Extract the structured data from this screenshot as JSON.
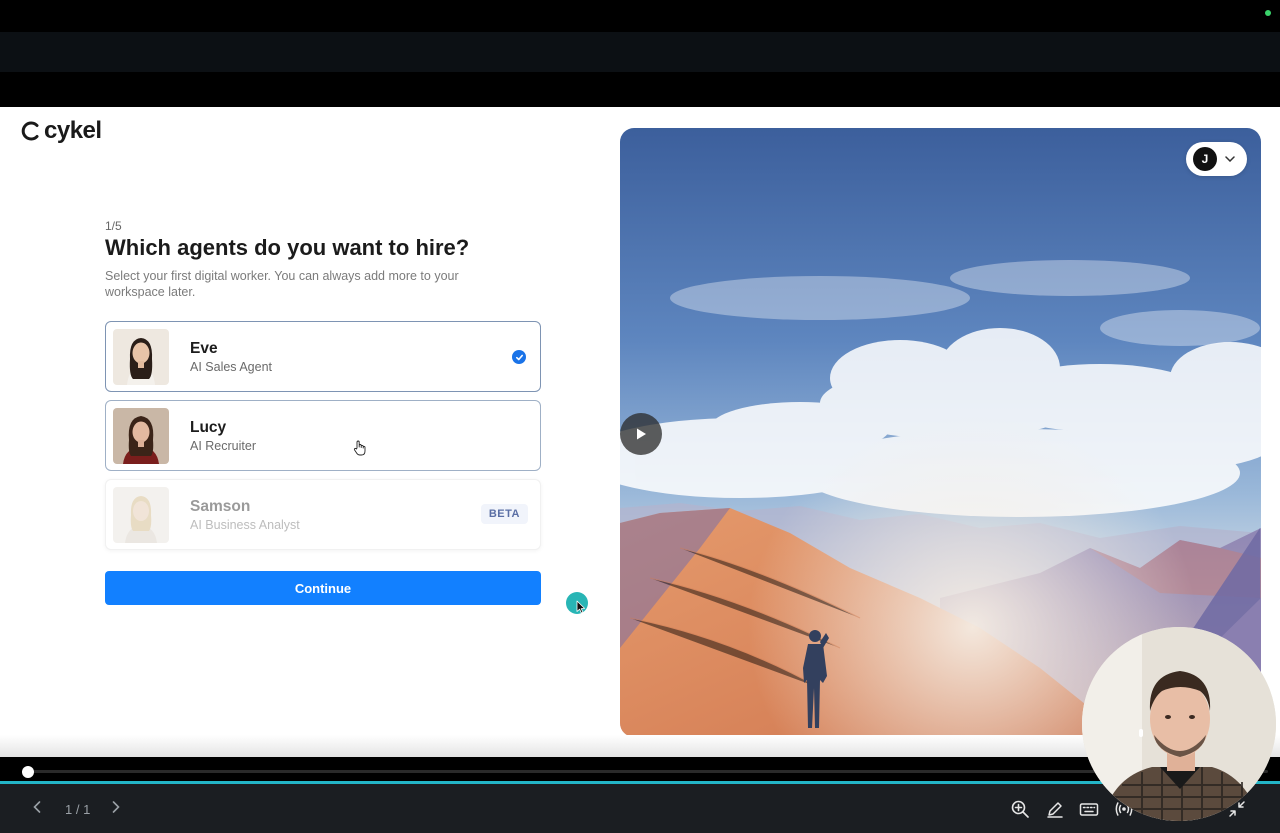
{
  "brand": {
    "name": "cykel"
  },
  "onboarding": {
    "step": "1/5",
    "title": "Which agents do you want to hire?",
    "subtitle": "Select your first digital worker. You can always add more to your workspace later.",
    "continue_label": "Continue"
  },
  "agents": [
    {
      "name": "Eve",
      "role": "AI Sales Agent",
      "selected": true
    },
    {
      "name": "Lucy",
      "role": "AI Recruiter",
      "selected": false
    },
    {
      "name": "Samson",
      "role": "AI Business Analyst",
      "badge": "BETA",
      "disabled": true
    }
  ],
  "user": {
    "initial": "J"
  },
  "player": {
    "page": "1 / 1",
    "progress": 0.005
  },
  "colors": {
    "accent": "#1280ff",
    "check": "#1a73e8",
    "teal": "#23b5c7"
  },
  "icons": [
    "chevron-left-icon",
    "chevron-right-icon",
    "zoom-in-icon",
    "pen-icon",
    "keyboard-icon",
    "broadcast-icon",
    "minimize-icon",
    "play-icon",
    "chevron-down-icon",
    "check-icon"
  ]
}
